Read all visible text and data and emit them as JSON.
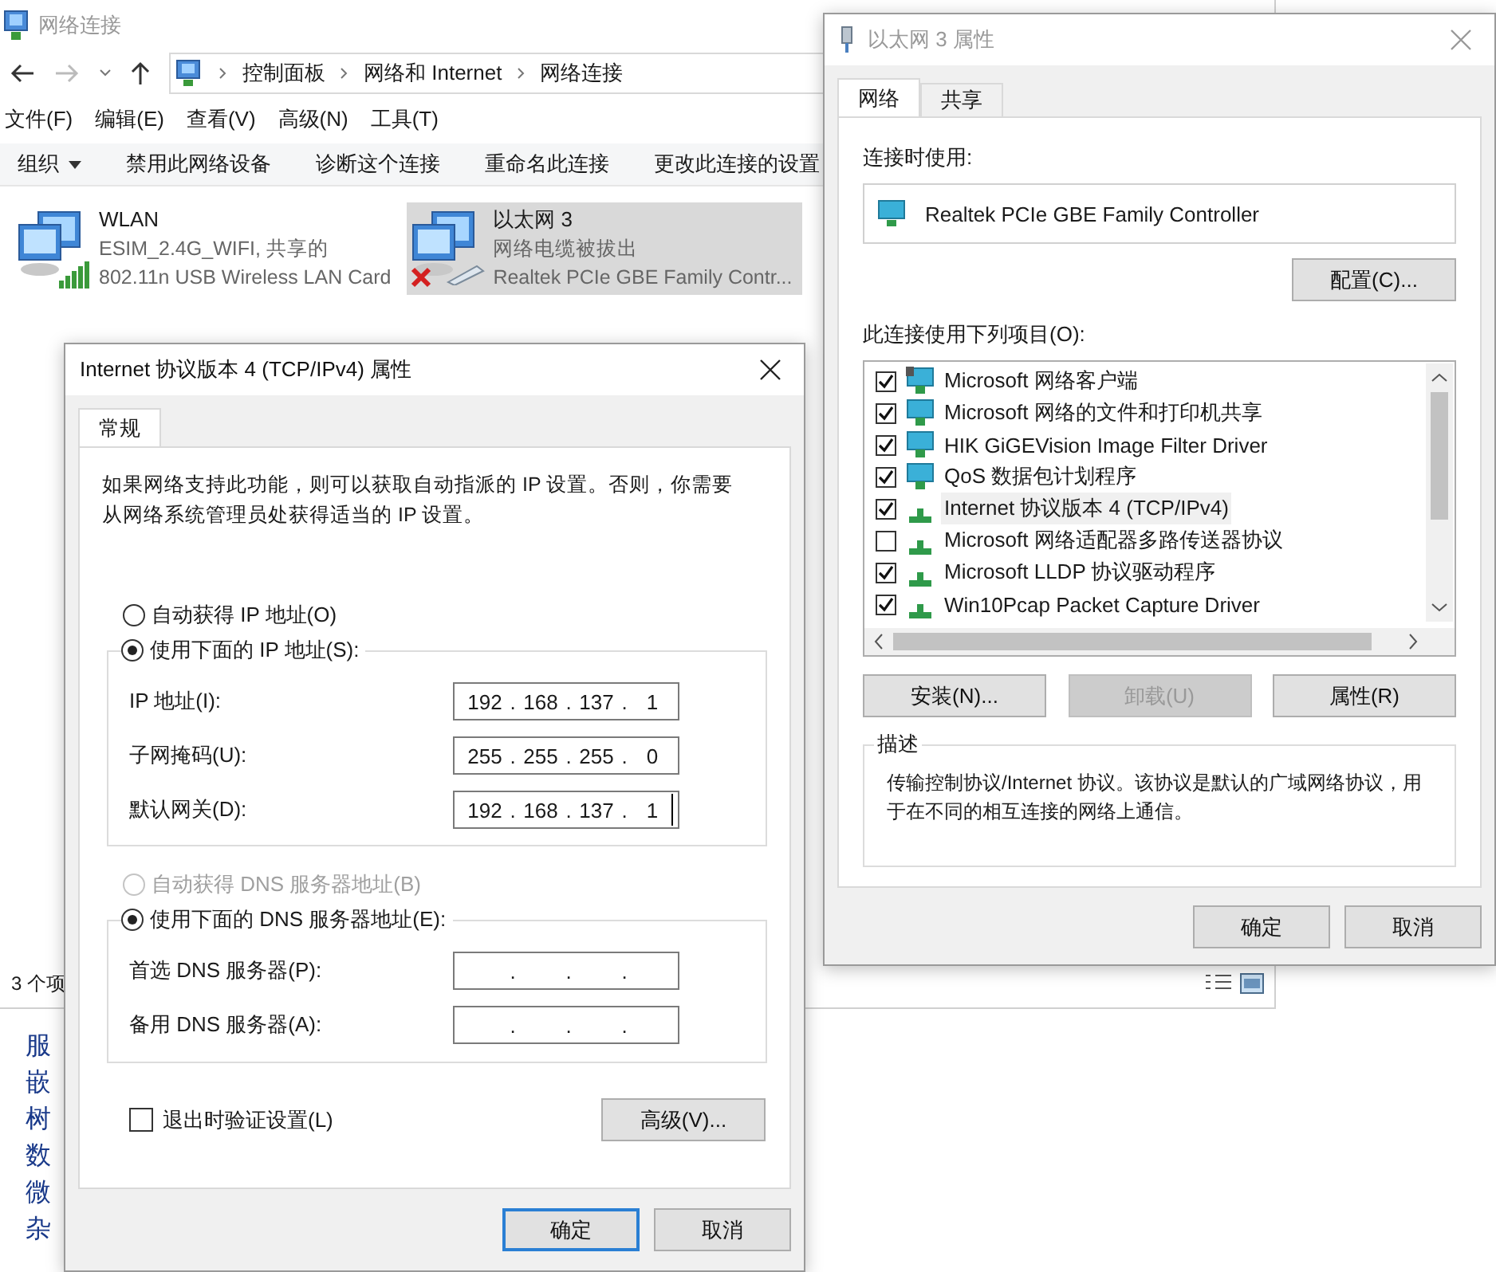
{
  "explorer": {
    "title": "网络连接",
    "breadcrumb": [
      "控制面板",
      "网络和 Internet",
      "网络连接"
    ],
    "menu": [
      "文件(F)",
      "编辑(E)",
      "查看(V)",
      "高级(N)",
      "工具(T)"
    ],
    "commands": [
      {
        "label": "组织",
        "dropdown": true
      },
      {
        "label": "禁用此网络设备",
        "dropdown": false
      },
      {
        "label": "诊断这个连接",
        "dropdown": false
      },
      {
        "label": "重命名此连接",
        "dropdown": false
      },
      {
        "label": "更改此连接的设置",
        "dropdown": false
      }
    ],
    "connections": [
      {
        "name": "WLAN",
        "status": "ESIM_2.4G_WIFI, 共享的",
        "device": "802.11n USB Wireless LAN Card",
        "kind": "wifi",
        "disconnected": false,
        "selected": false
      },
      {
        "name": "以太网 3",
        "status": "网络电缆被拔出",
        "device": "Realtek PCIe GBE Family Contr...",
        "kind": "ethernet",
        "disconnected": true,
        "selected": true
      }
    ],
    "status": "3 个项"
  },
  "behind_list": [
    "服",
    "嵌",
    "树",
    "数",
    "微",
    "杂"
  ],
  "adapter_dialog": {
    "title": "以太网 3 属性",
    "tabs": [
      {
        "label": "网络",
        "selected": true
      },
      {
        "label": "共享",
        "selected": false
      }
    ],
    "connect_using_label": "连接时使用:",
    "adapter": "Realtek PCIe GBE Family Controller",
    "configure_button": "配置(C)...",
    "items_label": "此连接使用下列项目(O):",
    "items": [
      {
        "label": "Microsoft 网络客户端",
        "kind": "client",
        "checked": true,
        "selected": false
      },
      {
        "label": "Microsoft 网络的文件和打印机共享",
        "kind": "service",
        "checked": true,
        "selected": false
      },
      {
        "label": "HIK GiGEVision Image Filter Driver",
        "kind": "service",
        "checked": true,
        "selected": false
      },
      {
        "label": "QoS 数据包计划程序",
        "kind": "service",
        "checked": true,
        "selected": false
      },
      {
        "label": "Internet 协议版本 4 (TCP/IPv4)",
        "kind": "protocol",
        "checked": true,
        "selected": true
      },
      {
        "label": "Microsoft 网络适配器多路传送器协议",
        "kind": "protocol",
        "checked": false,
        "selected": false
      },
      {
        "label": "Microsoft LLDP 协议驱动程序",
        "kind": "protocol",
        "checked": true,
        "selected": false
      },
      {
        "label": "Win10Pcap Packet Capture Driver",
        "kind": "protocol",
        "checked": true,
        "selected": false
      }
    ],
    "item_buttons": [
      {
        "label": "安装(N)...",
        "disabled": false
      },
      {
        "label": "卸载(U)",
        "disabled": true
      },
      {
        "label": "属性(R)",
        "disabled": false
      }
    ],
    "description_label": "描述",
    "description": "传输控制协议/Internet 协议。该协议是默认的广域网络协议，用于在不同的相互连接的网络上通信。",
    "ok": "确定",
    "cancel": "取消"
  },
  "ipv4_dialog": {
    "title": "Internet 协议版本 4 (TCP/IPv4) 属性",
    "tabs": [
      {
        "label": "常规",
        "selected": true
      }
    ],
    "intro": "如果网络支持此功能，则可以获取自动指派的 IP 设置。否则，你需要从网络系统管理员处获得适当的 IP 设置。",
    "octet_separator": ".",
    "ip_options": [
      {
        "label": "自动获得 IP 地址(O)",
        "selected": false,
        "disabled": false
      },
      {
        "label": "使用下面的 IP 地址(S):",
        "selected": true,
        "disabled": false
      }
    ],
    "ip_fields": [
      {
        "label": "IP 地址(I):",
        "octets": [
          "192",
          "168",
          "137",
          "1"
        ],
        "focused": false
      },
      {
        "label": "子网掩码(U):",
        "octets": [
          "255",
          "255",
          "255",
          "0"
        ],
        "focused": false
      },
      {
        "label": "默认网关(D):",
        "octets": [
          "192",
          "168",
          "137",
          "1"
        ],
        "focused": true
      }
    ],
    "dns_options": [
      {
        "label": "自动获得 DNS 服务器地址(B)",
        "selected": false,
        "disabled": true
      },
      {
        "label": "使用下面的 DNS 服务器地址(E):",
        "selected": true,
        "disabled": false
      }
    ],
    "dns_fields": [
      {
        "label": "首选 DNS 服务器(P):",
        "focused": false
      },
      {
        "label": "备用 DNS 服务器(A):",
        "focused": false
      }
    ],
    "validate": {
      "label": "退出时验证设置(L)",
      "checked": false
    },
    "advanced_button": "高级(V)...",
    "ok": "确定",
    "cancel": "取消"
  }
}
